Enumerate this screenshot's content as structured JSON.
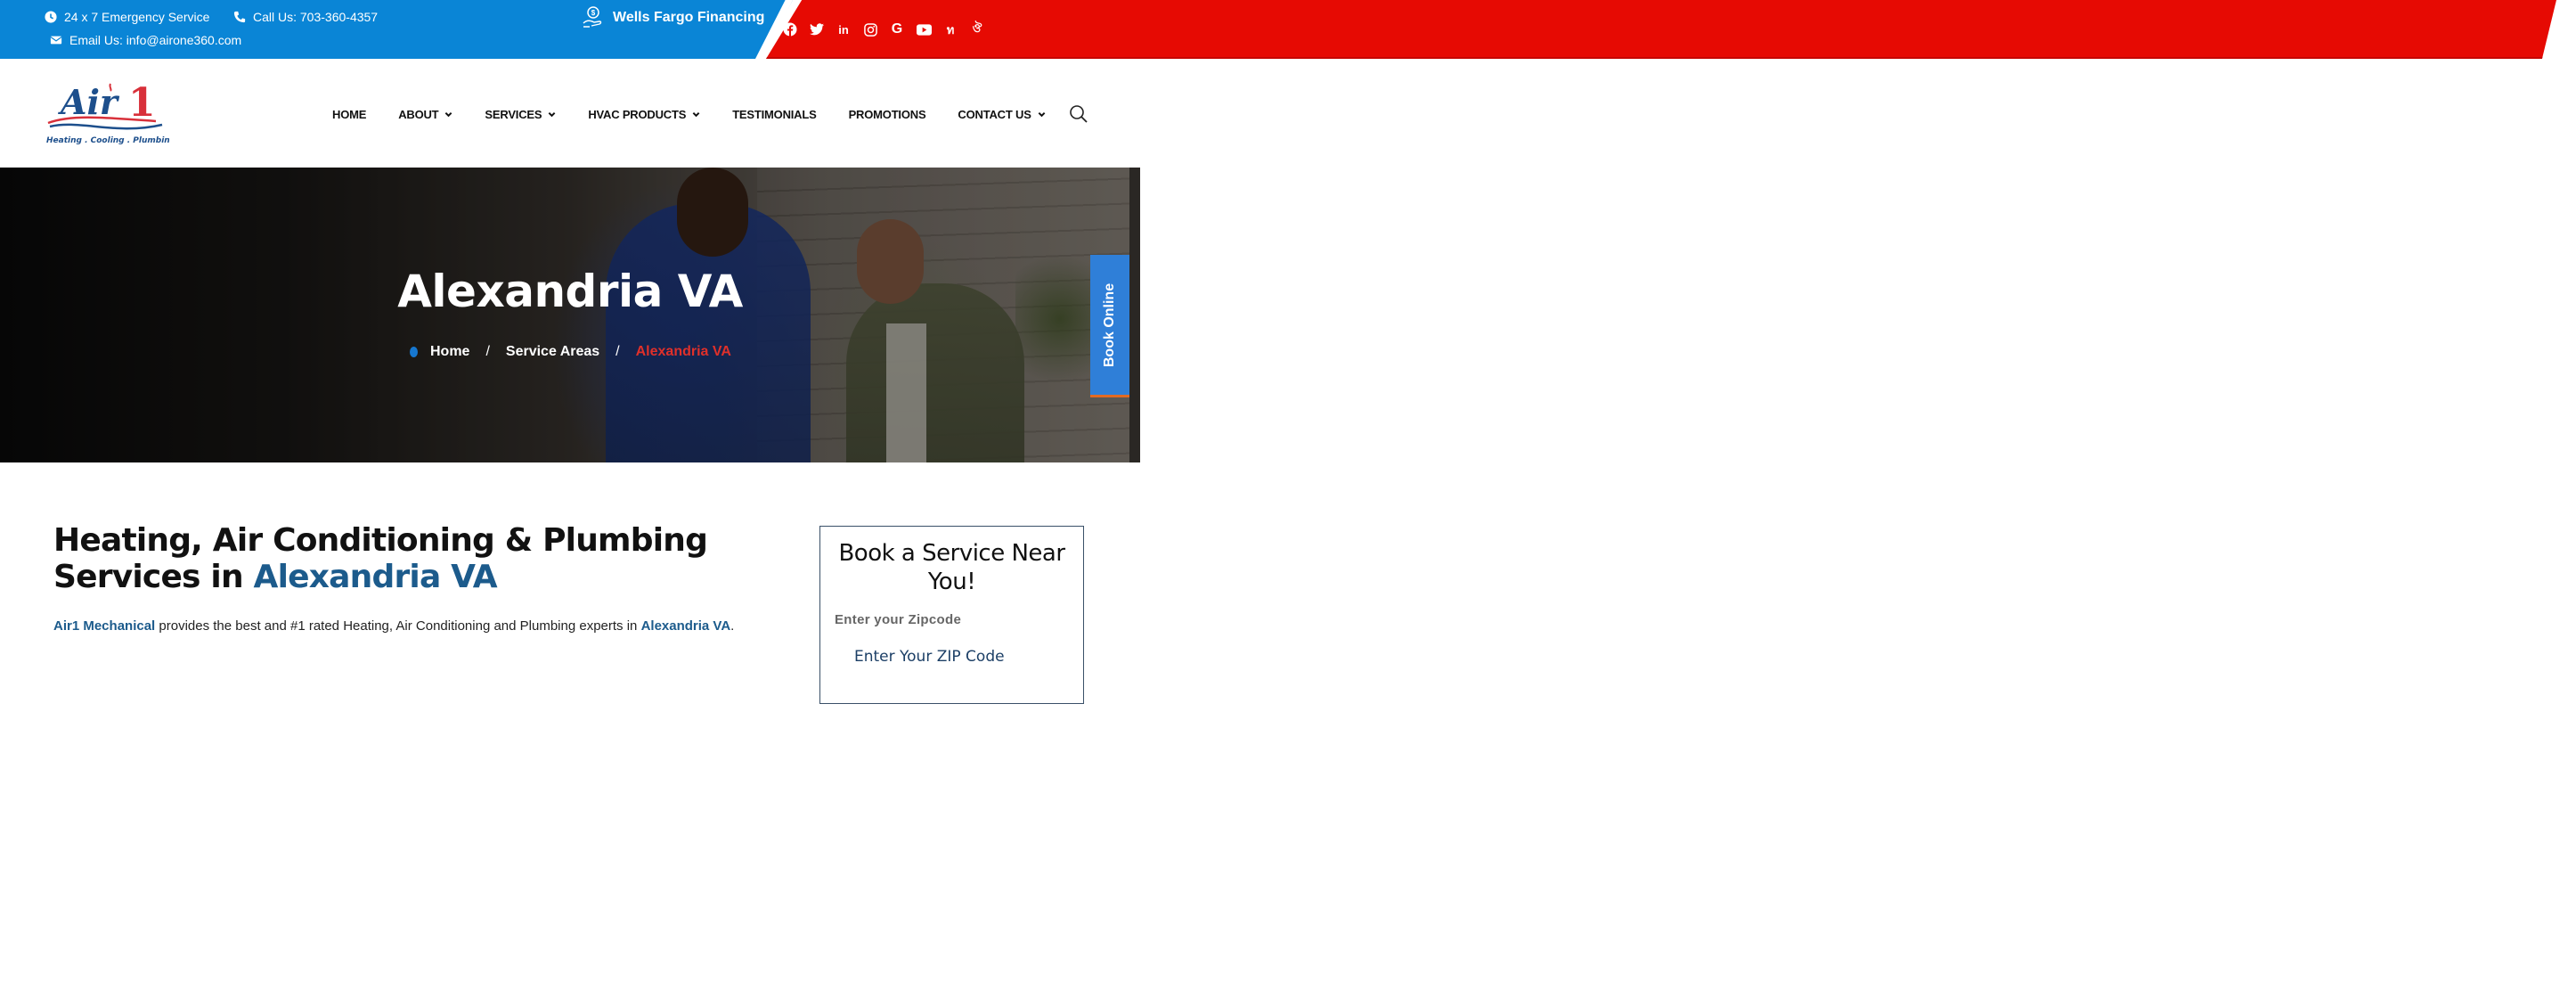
{
  "topbar": {
    "emergency": "24 x 7 Emergency Service",
    "call": "Call Us: 703-360-4357",
    "email": "Email Us: info@airone360.com",
    "financing": "Wells Fargo Financing",
    "social": [
      {
        "name": "facebook",
        "glyph": "f"
      },
      {
        "name": "twitter",
        "glyph": "t"
      },
      {
        "name": "linkedin",
        "glyph": "in"
      },
      {
        "name": "instagram",
        "glyph": "◎"
      },
      {
        "name": "google",
        "glyph": "G"
      },
      {
        "name": "youtube",
        "glyph": "▶"
      },
      {
        "name": "yelp",
        "glyph": "ท"
      },
      {
        "name": "nextdoor",
        "glyph": "ঔ"
      }
    ],
    "colors": {
      "blue": "#0a85d6",
      "red": "#e60a03"
    }
  },
  "header": {
    "logo": {
      "name": "Air 1",
      "tagline": "Heating . Cooling . Plumbing"
    },
    "nav": [
      {
        "label": "HOME",
        "dropdown": false
      },
      {
        "label": "ABOUT",
        "dropdown": true
      },
      {
        "label": "SERVICES",
        "dropdown": true
      },
      {
        "label": "HVAC PRODUCTS",
        "dropdown": true
      },
      {
        "label": "TESTIMONIALS",
        "dropdown": false
      },
      {
        "label": "PROMOTIONS",
        "dropdown": false
      },
      {
        "label": "CONTACT US",
        "dropdown": true
      }
    ]
  },
  "hero": {
    "title": "Alexandria VA",
    "breadcrumb": {
      "home": "Home",
      "separator": "/",
      "parent": "Service Areas",
      "current": "Alexandria VA"
    },
    "book_online": "Book Online"
  },
  "main": {
    "title_prefix": "Heating, Air Conditioning & Plumbing Services in ",
    "title_accent": "Alexandria VA",
    "text_company": "Air1 Mechanical",
    "text_body": " provides the best and #1 rated Heating, Air Conditioning and Plumbing experts in ",
    "text_location": "Alexandria VA",
    "text_end": "."
  },
  "booking": {
    "title": "Book a Service Near You!",
    "zip_label": "Enter your Zipcode",
    "zip_placeholder": "Enter Your ZIP Code",
    "zip_value": ""
  }
}
